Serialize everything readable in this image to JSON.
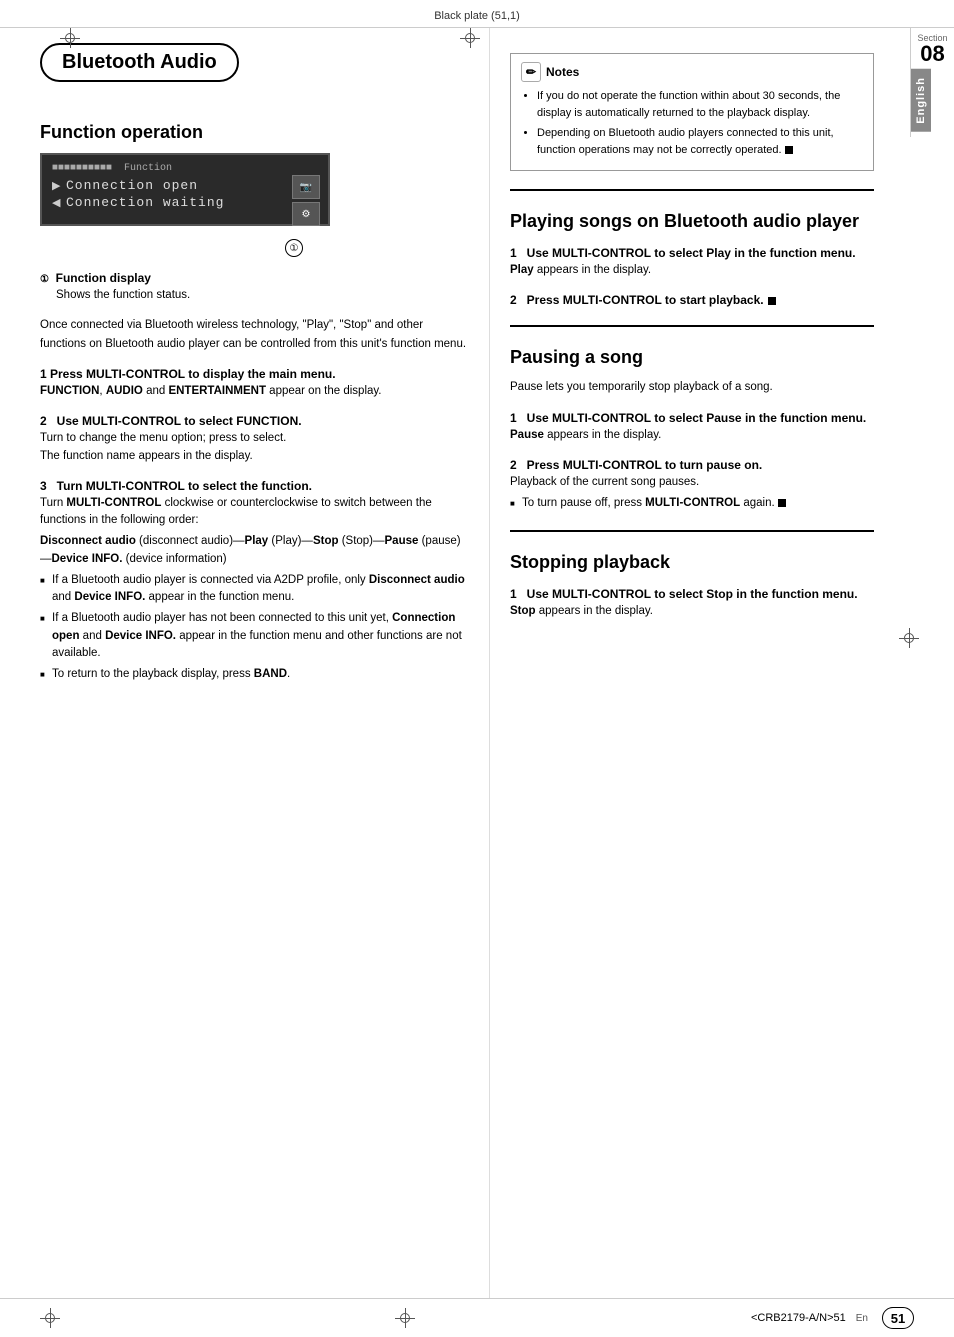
{
  "header": {
    "text": "Black plate (51,1)"
  },
  "title": "Bluetooth Audio",
  "section": {
    "label": "Section",
    "number": "08",
    "language": "English"
  },
  "left": {
    "section_title": "Function operation",
    "function_display": {
      "title": "Function",
      "row1": "Connection open",
      "row2": "Connection waiting",
      "arrow1": "▶",
      "arrow2": "◀"
    },
    "callout1_label": "①",
    "callout1_title": "Function display",
    "callout1_desc": "Shows the function status.",
    "intro_para": "Once connected via Bluetooth wireless technology, \"Play\", \"Stop\" and other functions on Bluetooth audio player can be controlled from this unit's function menu.",
    "step1_heading": "1   Press MULTI-CONTROL to display the main menu.",
    "step1_body": "FUNCTION, AUDIO and ENTERTAINMENT appear on the display.",
    "step2_heading": "2   Use MULTI-CONTROL to select FUNCTION.",
    "step2_body": "Turn to change the menu option; press to select.\nThe function name appears in the display.",
    "step3_heading": "3   Turn MULTI-CONTROL to select the function.",
    "step3_body": "Turn MULTI-CONTROL clockwise or counterclockwise to switch between the functions in the following order:",
    "step3_order": "Disconnect audio (disconnect audio)—Play (Play)—Stop (Stop)—Pause (pause)—Device INFO. (device information)",
    "bullet1": "If a Bluetooth audio player is connected via A2DP profile, only Disconnect audio and Device INFO. appear in the function menu.",
    "bullet2": "If a Bluetooth audio player has not been connected to this unit yet, Connection open and Device INFO. appear in the function menu and other functions are not available.",
    "bullet3": "To return to the playback display, press BAND."
  },
  "right": {
    "notes_title": "Notes",
    "note1": "If you do not operate the function within about 30 seconds, the display is automatically returned to the playback display.",
    "note2": "Depending on Bluetooth audio players connected to this unit, function operations may not be correctly operated.",
    "section2_title": "Playing songs on Bluetooth audio player",
    "play_step1_heading": "1   Use MULTI-CONTROL to select Play in the function menu.",
    "play_step1_body": "Play appears in the display.",
    "play_step2_heading": "2   Press MULTI-CONTROL to start playback.",
    "section3_title": "Pausing a song",
    "pause_intro": "Pause lets you temporarily stop playback of a song.",
    "pause_step1_heading": "1   Use MULTI-CONTROL to select Pause in the function menu.",
    "pause_step1_body": "Pause appears in the display.",
    "pause_step2_heading": "2   Press MULTI-CONTROL to turn pause on.",
    "pause_step2_body": "Playback of the current song pauses.",
    "pause_bullet1": "To turn pause off, press MULTI-CONTROL again.",
    "section4_title": "Stopping playback",
    "stop_step1_heading": "1   Use MULTI-CONTROL to select Stop in the function menu.",
    "stop_step1_body": "Stop appears in the display."
  },
  "footer": {
    "en_label": "En",
    "page_number": "51",
    "crb_code": "<CRB2179-A/N>51"
  }
}
